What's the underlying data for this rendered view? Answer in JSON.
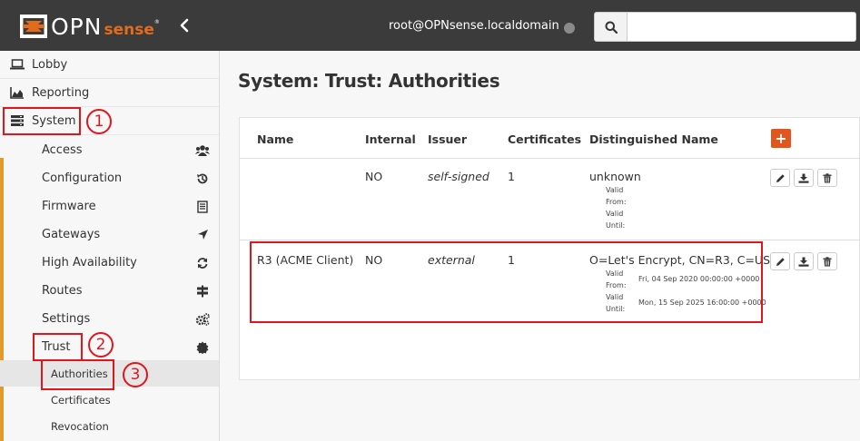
{
  "header": {
    "logo_opn": "OPN",
    "logo_sense": "sense",
    "logo_tm": "®",
    "collapse_icon": "chevron-left-icon",
    "user": "root@OPNsense.localdomain",
    "search_placeholder": "",
    "search_value": ""
  },
  "sidebar": {
    "lobby": "Lobby",
    "reporting": "Reporting",
    "system": "System",
    "system_sub": [
      {
        "label": "Access",
        "icon": "users-icon"
      },
      {
        "label": "Configuration",
        "icon": "history-icon"
      },
      {
        "label": "Firmware",
        "icon": "document-icon"
      },
      {
        "label": "Gateways",
        "icon": "location-arrow-icon"
      },
      {
        "label": "High Availability",
        "icon": "refresh-icon"
      },
      {
        "label": "Routes",
        "icon": "signpost-icon"
      },
      {
        "label": "Settings",
        "icon": "gears-icon"
      },
      {
        "label": "Trust",
        "icon": "certificate-icon"
      }
    ],
    "trust_sub": [
      "Authorities",
      "Certificates",
      "Revocation"
    ]
  },
  "annotations": {
    "step1": "1",
    "step2": "2",
    "step3": "3"
  },
  "page": {
    "title": "System: Trust: Authorities",
    "columns": [
      "Name",
      "Internal",
      "Issuer",
      "Certificates",
      "Distinguished Name"
    ],
    "add_label": "+",
    "rows": [
      {
        "name": "",
        "internal": "NO",
        "issuer": "self-signed",
        "certificates": "1",
        "dn": "unknown",
        "valid_from_label": "Valid From:",
        "valid_from": "",
        "valid_until_label": "Valid Until:",
        "valid_until": ""
      },
      {
        "name": "R3 (ACME Client)",
        "internal": "NO",
        "issuer": "external",
        "certificates": "1",
        "dn": "O=Let's Encrypt, CN=R3, C=US",
        "valid_from_label": "Valid From:",
        "valid_from": "Fri, 04 Sep 2020 00:00:00 +0000",
        "valid_until_label": "Valid Until:",
        "valid_until": "Mon, 15 Sep 2025 16:00:00 +0000"
      }
    ]
  },
  "colors": {
    "accent": "#e2561d",
    "highlight": "#e0161f",
    "topbar": "#3b3b3b",
    "menu_bar": "#e39a2d"
  }
}
